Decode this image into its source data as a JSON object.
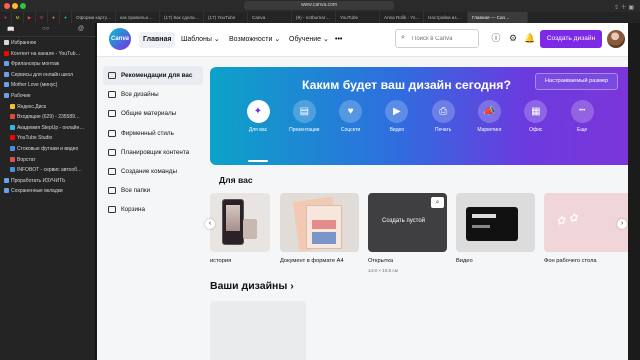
{
  "browser": {
    "url": "www.canva.com",
    "tabs": [
      "Оформи карту…",
      "как правильн…",
      "(17) Как сдела…",
      "(17) YouTube",
      "Canva",
      "(9) - notburnar…",
      "YouTube",
      "Anna Rolik - Yo…",
      "Настройки из…",
      "Главная — Can…"
    ],
    "active_tab": "Главная — Can…"
  },
  "safari_sidebar": {
    "items": [
      {
        "label": "Избранное",
        "indent": false,
        "color": "#d9d9d9"
      },
      {
        "label": "Контент на канале - YouTub…",
        "indent": false,
        "color": "#ff0000"
      },
      {
        "label": "Фрилансеры монтаж",
        "indent": false,
        "color": "#6aa0e8"
      },
      {
        "label": "Сервисы для онлайн школ",
        "indent": false,
        "color": "#6aa0e8"
      },
      {
        "label": "Mother Love (минус)",
        "indent": false,
        "color": "#6aa0e8"
      },
      {
        "label": "Рабочие",
        "indent": false,
        "color": "#6aa0e8"
      },
      {
        "label": "Яндекс.Диск",
        "indent": true,
        "color": "#f2c230"
      },
      {
        "label": "Входящие (629) - 235589…",
        "indent": true,
        "color": "#e04a3a"
      },
      {
        "label": "Академия StepUp - онлайн…",
        "indent": true,
        "color": "#3bb4e0"
      },
      {
        "label": "YouTube Studio",
        "indent": true,
        "color": "#ff0000"
      },
      {
        "label": "Стоковые футажи и видео",
        "indent": true,
        "color": "#4a8ee0"
      },
      {
        "label": "Ворстат",
        "indent": true,
        "color": "#e05050"
      },
      {
        "label": "INFOBOT - сервис автооб…",
        "indent": true,
        "color": "#4a8ee0"
      },
      {
        "label": "Проработать ИЗУЧИТЬ",
        "indent": false,
        "color": "#6aa0e8"
      },
      {
        "label": "Сохраненные вкладки",
        "indent": false,
        "color": "#6aa0e8"
      }
    ]
  },
  "canva": {
    "logo": "Canva",
    "nav": {
      "home": "Главная",
      "templates": "Шаблоны",
      "features": "Возможности",
      "learn": "Обучение",
      "more": "•••"
    },
    "search": {
      "placeholder": "Поиск в Canva",
      "value": ""
    },
    "create_button": "Создать дизайн",
    "left_nav": [
      "Рекомендации для вас",
      "Все дизайны",
      "Общие материалы",
      "Фирменный стиль",
      "Планировщик контента",
      "Создание команды",
      "Все папки",
      "Корзина"
    ],
    "hero": {
      "title": "Каким будет ваш дизайн сегодня?",
      "custom_size_button": "Настраиваемый размер",
      "categories": [
        {
          "label": "Для вас",
          "icon": "sparkle-icon"
        },
        {
          "label": "Презентации",
          "icon": "presentation-icon"
        },
        {
          "label": "Соцсети",
          "icon": "heart-icon"
        },
        {
          "label": "Видео",
          "icon": "video-icon"
        },
        {
          "label": "Печать",
          "icon": "print-icon"
        },
        {
          "label": "Маркетинг",
          "icon": "megaphone-icon"
        },
        {
          "label": "Офис",
          "icon": "briefcase-icon"
        },
        {
          "label": "Еще",
          "icon": "more-icon"
        }
      ]
    },
    "for_you": {
      "title": "Для вас",
      "cards": [
        {
          "label": "история",
          "sub": ""
        },
        {
          "label": "Документ в формате A4",
          "sub": ""
        },
        {
          "label": "Открытка",
          "sub": "14.8 × 10.5 см"
        },
        {
          "label": "Видео",
          "sub": ""
        },
        {
          "label": "Фон рабочего стола",
          "sub": ""
        }
      ],
      "hover_action": "Создать пустой"
    },
    "your_designs": "Ваши дизайны ›"
  }
}
